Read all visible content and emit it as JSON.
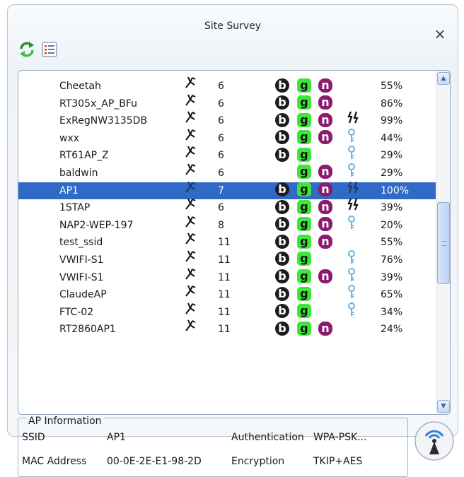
{
  "window": {
    "title": "Site Survey"
  },
  "toolbar": {
    "refresh_icon": "refresh-icon",
    "list_icon": "list-view-icon"
  },
  "close": {
    "label": "×"
  },
  "networks": [
    {
      "ssid": "Cheetah",
      "channel": "6",
      "b": true,
      "g": true,
      "n": true,
      "security": "",
      "signal": "55%"
    },
    {
      "ssid": "RT305x_AP_BFu",
      "channel": "6",
      "b": true,
      "g": true,
      "n": true,
      "security": "",
      "signal": "86%"
    },
    {
      "ssid": "ExRegNW3135DB",
      "channel": "6",
      "b": true,
      "g": true,
      "n": true,
      "security": "wpa",
      "signal": "99%"
    },
    {
      "ssid": "wxx",
      "channel": "6",
      "b": true,
      "g": true,
      "n": true,
      "security": "wep",
      "signal": "44%"
    },
    {
      "ssid": "RT61AP_Z",
      "channel": "6",
      "b": true,
      "g": true,
      "n": false,
      "security": "wep",
      "signal": "29%"
    },
    {
      "ssid": "baldwin",
      "channel": "6",
      "b": false,
      "g": true,
      "n": true,
      "security": "wep",
      "signal": "29%"
    },
    {
      "ssid": "AP1",
      "channel": "7",
      "b": true,
      "g": true,
      "n": true,
      "security": "wpa",
      "signal": "100%",
      "selected": true
    },
    {
      "ssid": "1STAP",
      "channel": "6",
      "b": true,
      "g": true,
      "n": true,
      "security": "wpa",
      "signal": "39%"
    },
    {
      "ssid": "NAP2-WEP-197",
      "channel": "8",
      "b": true,
      "g": true,
      "n": true,
      "security": "wep",
      "signal": "20%"
    },
    {
      "ssid": "test_ssid",
      "channel": "11",
      "b": true,
      "g": true,
      "n": true,
      "security": "",
      "signal": "55%"
    },
    {
      "ssid": "VWIFI-S1",
      "channel": "11",
      "b": true,
      "g": true,
      "n": false,
      "security": "wep",
      "signal": "76%"
    },
    {
      "ssid": "VWIFI-S1",
      "channel": "11",
      "b": true,
      "g": true,
      "n": true,
      "security": "wep",
      "signal": "39%"
    },
    {
      "ssid": "ClaudeAP",
      "channel": "11",
      "b": true,
      "g": true,
      "n": false,
      "security": "wep",
      "signal": "65%"
    },
    {
      "ssid": "FTC-02",
      "channel": "11",
      "b": true,
      "g": true,
      "n": false,
      "security": "wep",
      "signal": "34%"
    },
    {
      "ssid": "RT2860AP1",
      "channel": "11",
      "b": true,
      "g": true,
      "n": true,
      "security": "",
      "signal": "24%"
    }
  ],
  "badges": {
    "b": "b",
    "g": "g",
    "n": "n"
  },
  "ap_info": {
    "legend": "AP Information",
    "ssid_label": "SSID",
    "ssid_value": "AP1",
    "mac_label": "MAC Address",
    "mac_value": "00-0E-2E-E1-98-2D",
    "auth_label": "Authentication",
    "auth_value": "WPA-PSK...",
    "enc_label": "Encryption",
    "enc_value": "TKIP+AES"
  },
  "colors": {
    "selected_row": "#3169c6",
    "badge_b": "#1d1d1d",
    "badge_g": "#3ee63a",
    "badge_n": "#8a1b6e",
    "wep_key": "#6fb3d9"
  }
}
